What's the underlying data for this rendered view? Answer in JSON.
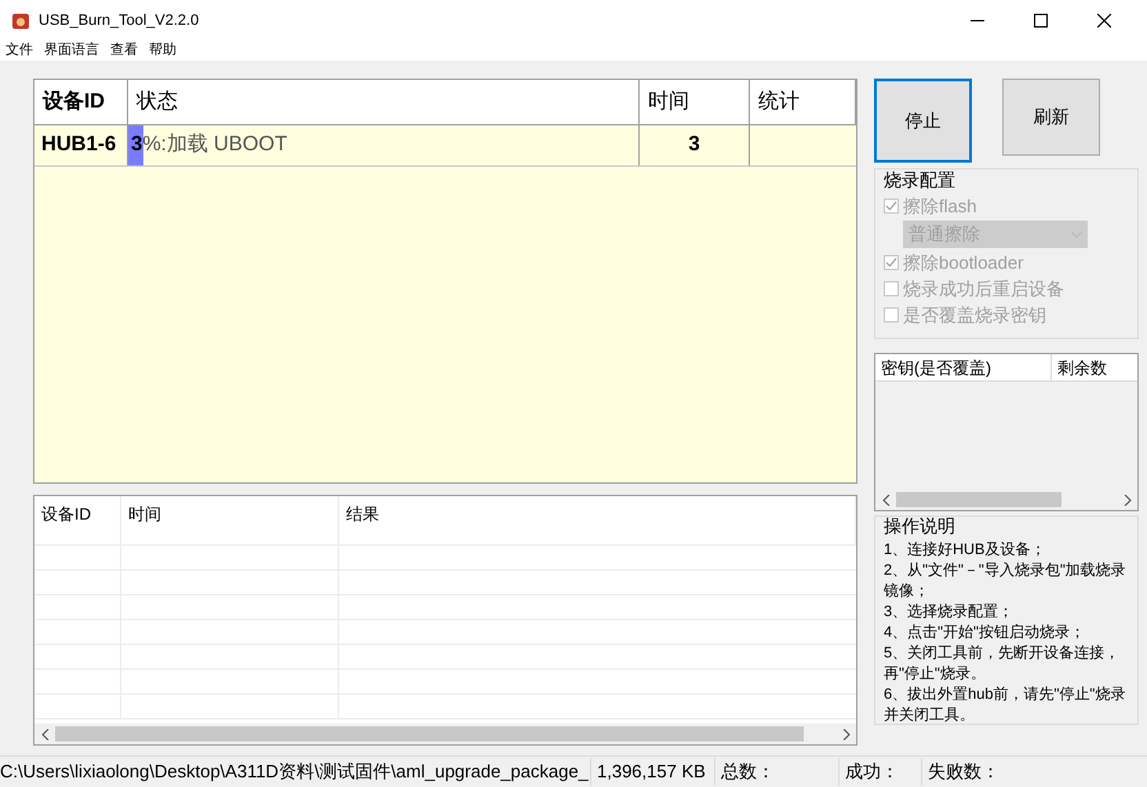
{
  "window": {
    "title": "USB_Burn_Tool_V2.2.0"
  },
  "menu": [
    "文件",
    "界面语言",
    "查看",
    "帮助"
  ],
  "device_table": {
    "columns": [
      "设备ID",
      "状态",
      "时间",
      "统计"
    ],
    "rows": [
      {
        "id": "HUB1-6",
        "status_percent": "3",
        "status_text": "%:加载 UBOOT",
        "level": 0.03,
        "time": "3"
      }
    ]
  },
  "buttons": [
    {
      "label": "停止",
      "focused": true
    },
    {
      "label": "刷新",
      "focused": false
    }
  ],
  "burn_config": {
    "title": "烧录配置",
    "options": [
      {
        "kind": "checkbox",
        "label": "擦除flash",
        "checked": true,
        "disabled": true
      },
      {
        "kind": "select",
        "value": "普通擦除",
        "disabled": true
      },
      {
        "kind": "checkbox",
        "label": "擦除bootloader",
        "checked": true,
        "disabled": true
      },
      {
        "kind": "checkbox",
        "label": "烧录成功后重启设备",
        "checked": false,
        "disabled": true
      },
      {
        "kind": "checkbox",
        "label": "是否覆盖烧录密钥",
        "checked": false,
        "disabled": true
      }
    ]
  },
  "key_table": {
    "columns": [
      "密钥(是否覆盖)",
      "剩余数"
    ]
  },
  "instructions": {
    "title": "操作说明",
    "text": "1、连接好HUB及设备；\n2、从\"文件\"－\"导入烧录包\"加载烧录镜像；\n3、选择烧录配置；\n4、点击\"开始\"按钮启动烧录；\n5、关闭工具前，先断开设备连接，再\"停止\"烧录。\n6、拔出外置hub前，请先\"停止\"烧录并关闭工具。"
  },
  "log_table": {
    "columns": [
      "设备ID",
      "时间",
      "结果"
    ]
  },
  "status_bar": [
    "C:\\Users\\lixiaolong\\Desktop\\A311D资料\\测试固件\\aml_upgrade_package_",
    "1,396,157 KB",
    "总数：",
    "成功：",
    "失败数："
  ]
}
